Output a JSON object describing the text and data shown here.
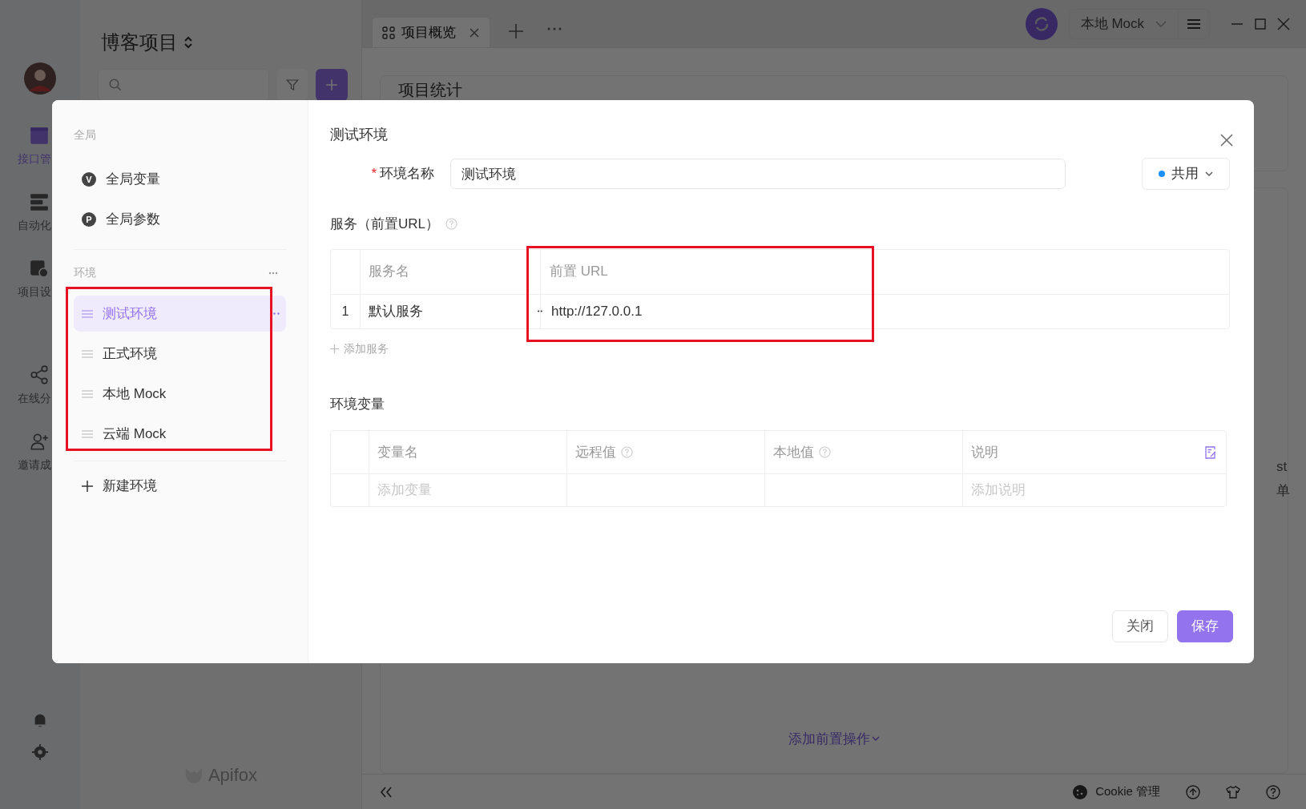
{
  "app": {
    "rail": [
      {
        "label": "接口管",
        "selected": true
      },
      {
        "label": "自动化",
        "selected": false
      },
      {
        "label": "项目设",
        "selected": false
      },
      {
        "label": "在线分",
        "selected": false
      },
      {
        "label": "邀请成",
        "selected": false
      }
    ],
    "project": "博客项目",
    "logo": "Apifox",
    "tabs": [
      {
        "label": "项目概览",
        "selected": true
      }
    ],
    "mock_env": "本地 Mock",
    "card_title": "项目统计",
    "fragments": [
      "st",
      "单"
    ],
    "add_pre_action": "添加前置操作",
    "status_bar": {
      "cookie": "Cookie 管理"
    }
  },
  "dialog": {
    "global_header": "全局",
    "global_items": [
      {
        "label": "全局变量",
        "badge": "V"
      },
      {
        "label": "全局参数",
        "badge": "P"
      }
    ],
    "env_header": "环境",
    "environments": [
      {
        "label": "测试环境",
        "selected": true
      },
      {
        "label": "正式环境",
        "selected": false
      },
      {
        "label": "本地 Mock",
        "selected": false
      },
      {
        "label": "云端 Mock",
        "selected": false
      }
    ],
    "new_env": "新建环境",
    "title": "测试环境",
    "name_label": "环境名称",
    "name_required": true,
    "required_mark": "*",
    "name_value": "测试环境",
    "scope": {
      "label": "共用",
      "color": "#1890ff"
    },
    "services_label": "服务（前置URL）",
    "services_columns": [
      "服务名",
      "前置 URL"
    ],
    "services_rows": [
      {
        "index": "1",
        "name": "默认服务",
        "url": "http://127.0.0.1"
      }
    ],
    "add_service": "添加服务",
    "vars_label": "环境变量",
    "vars_columns": [
      {
        "label": "变量名",
        "help": false,
        "placeholder": "添加变量"
      },
      {
        "label": "远程值",
        "help": true
      },
      {
        "label": "本地值",
        "help": true
      },
      {
        "label": "说明",
        "help": false,
        "placeholder": "添加说明"
      }
    ],
    "buttons": [
      {
        "label": "关闭",
        "kind": "secondary"
      },
      {
        "label": "保存",
        "kind": "primary"
      }
    ]
  }
}
